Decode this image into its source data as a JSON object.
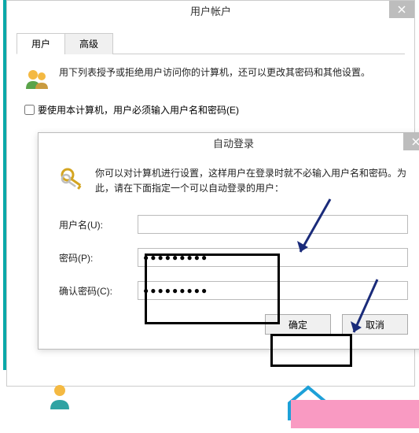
{
  "outer": {
    "title": "用户帐户",
    "tab_users": "用户",
    "tab_advanced": "高级",
    "info_text": "用下列表授予或拒绝用户访问你的计算机，还可以更改其密码和其他设置。",
    "checkbox_label": "要使用本计算机，用户必须输入用户名和密码(E)"
  },
  "inner": {
    "title": "自动登录",
    "info_text": "你可以对计算机进行设置，这样用户在登录时就不必输入用户名和密码。为此，请在下面指定一个可以自动登录的用户：",
    "label_username": "用户名(U):",
    "label_password": "密码(P):",
    "label_confirm": "确认密码(C):",
    "value_username": "",
    "value_password": "●●●●●●●●●",
    "value_confirm": "●●●●●●●●●",
    "btn_ok": "确定",
    "btn_cancel": "取消"
  },
  "colors": {
    "arrow": "#1a2b7a",
    "teal": "#0aa8a8",
    "pink": "#f99ac2"
  }
}
